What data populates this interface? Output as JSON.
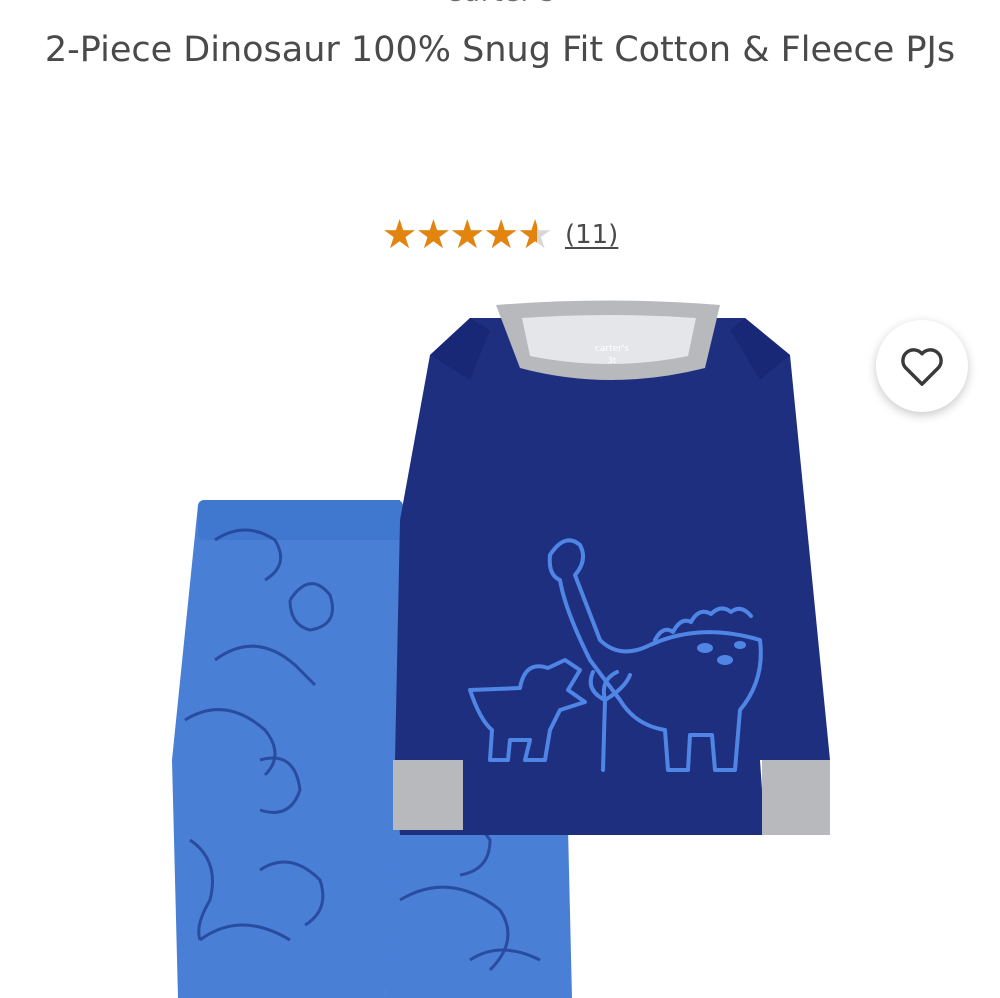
{
  "brand": {
    "partial_text": "Carter's"
  },
  "product": {
    "title": "2-Piece Dinosaur 100% Snug Fit Cotton & Fleece PJs",
    "garment_tag_brand": "carter's",
    "garment_tag_size": "3t"
  },
  "rating": {
    "value": 4.6,
    "out_of": 5,
    "stars_glyphs": "★★★★★",
    "review_count_label": "(11)",
    "star_color": "#e3840f"
  },
  "wishlist": {
    "icon": "heart-outline-icon"
  },
  "colors": {
    "shirt_navy": "#1f2f7f",
    "cuff_gray": "#b7b9bc",
    "pants_blue": "#4a7fd6",
    "dino_outline": "#4f86e6"
  }
}
